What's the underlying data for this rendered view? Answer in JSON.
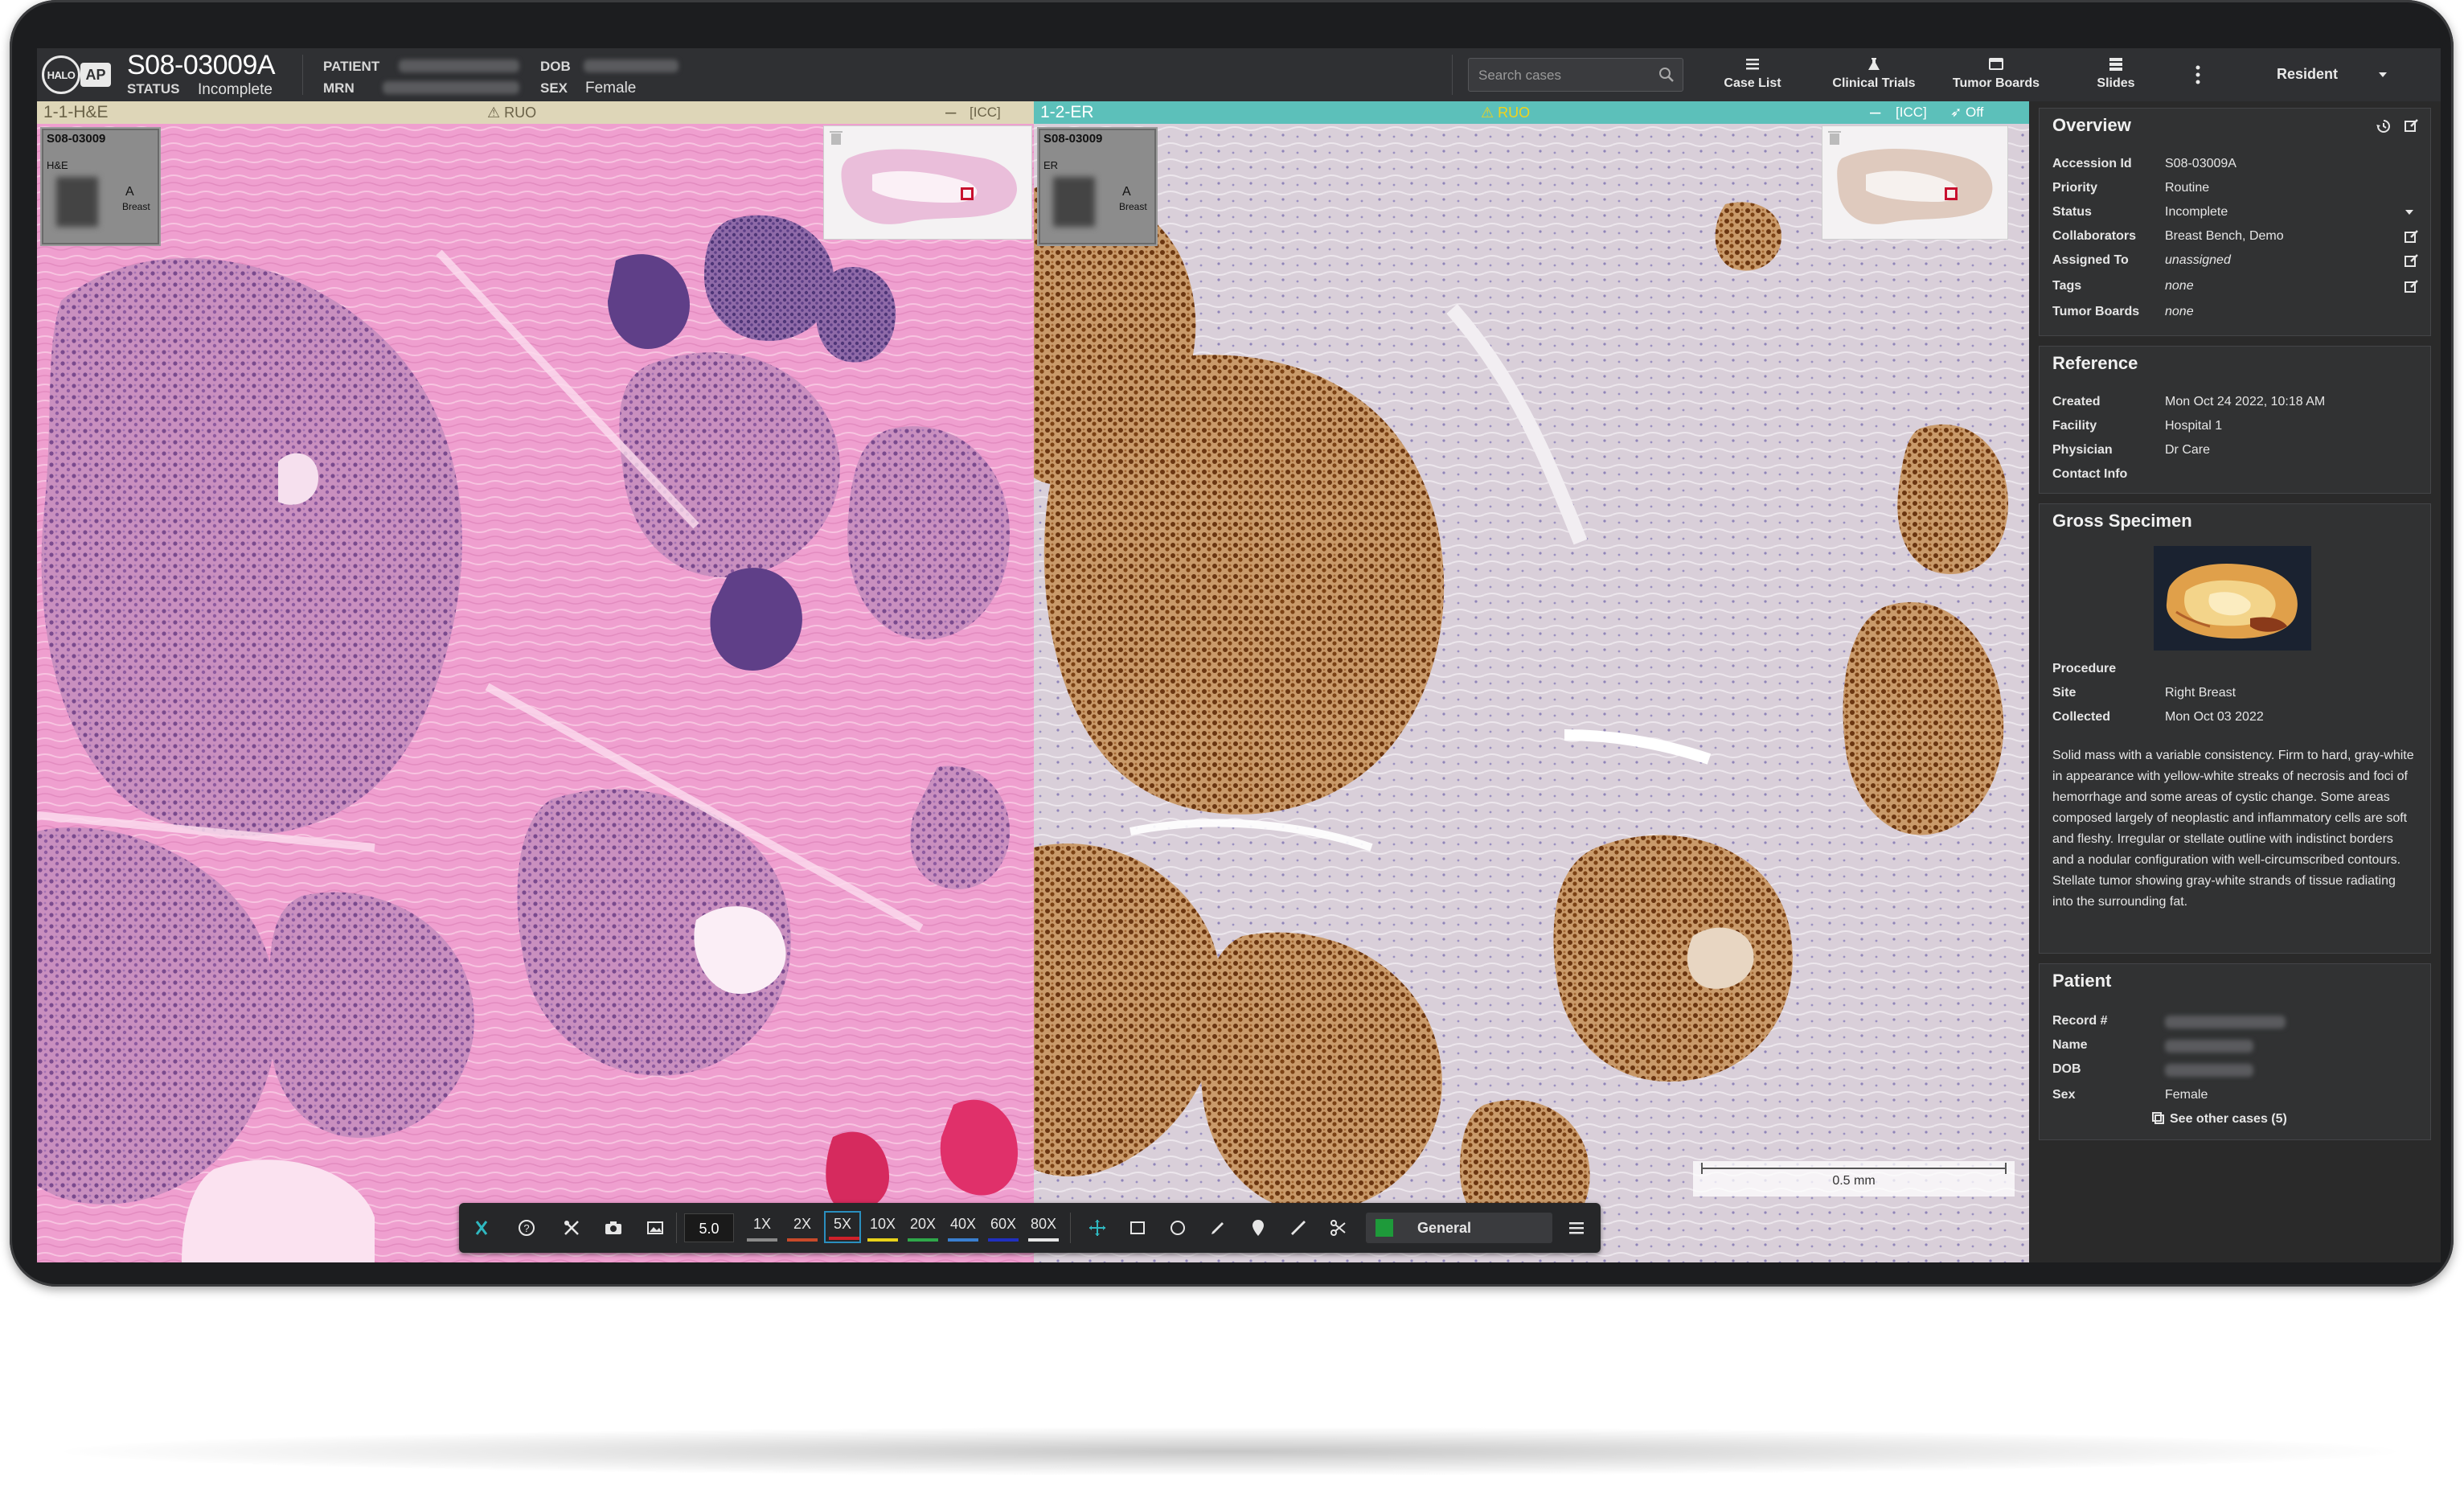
{
  "header": {
    "logo_halo": "HALO",
    "logo_ap": "AP",
    "case_id": "S08-03009A",
    "status_label": "STATUS",
    "status_value": "Incomplete",
    "patient_label": "PATIENT",
    "mrn_label": "MRN",
    "dob_label": "DOB",
    "sex_label": "SEX",
    "sex_value": "Female",
    "search_placeholder": "Search cases",
    "nav": [
      {
        "label": "Case List",
        "icon": "list-icon"
      },
      {
        "label": "Clinical Trials",
        "icon": "flask-icon"
      },
      {
        "label": "Tumor Boards",
        "icon": "board-icon"
      },
      {
        "label": "Slides",
        "icon": "slides-icon"
      }
    ],
    "user_label": "Resident"
  },
  "viewers": [
    {
      "title": "1-1-H&E",
      "ruo": "RUO",
      "icc": "[ICC]",
      "thumb_id": "S08-03009",
      "thumb_stain": "H&E",
      "thumb_letter": "A",
      "thumb_site": "Breast"
    },
    {
      "title": "1-2-ER",
      "ruo": "RUO",
      "icc": "[ICC]",
      "off": "Off",
      "thumb_id": "S08-03009",
      "thumb_stain": "ER",
      "thumb_letter": "A",
      "thumb_site": "Breast"
    }
  ],
  "scale_bar": "0.5 mm",
  "toolbar": {
    "zoom_value": "5.0",
    "magnifications": [
      {
        "label": "1X",
        "color": "#8a8a8a"
      },
      {
        "label": "2X",
        "color": "#c84a2a"
      },
      {
        "label": "5X",
        "color": "#d0202a",
        "active": true
      },
      {
        "label": "10X",
        "color": "#e8d21a"
      },
      {
        "label": "20X",
        "color": "#2fa84a"
      },
      {
        "label": "40X",
        "color": "#3a7fd0"
      },
      {
        "label": "60X",
        "color": "#2030c0"
      },
      {
        "label": "80X",
        "color": "#e6e6e6"
      }
    ],
    "layer_name": "General",
    "layer_color": "#1e9a3a"
  },
  "overview": {
    "title": "Overview",
    "rows": [
      {
        "key": "Accession Id",
        "value": "S08-03009A"
      },
      {
        "key": "Priority",
        "value": "Routine"
      },
      {
        "key": "Status",
        "value": "Incomplete"
      },
      {
        "key": "Collaborators",
        "value": "Breast Bench, Demo"
      },
      {
        "key": "Assigned To",
        "value": "unassigned"
      },
      {
        "key": "Tags",
        "value": "none"
      },
      {
        "key": "Tumor Boards",
        "value": "none"
      }
    ]
  },
  "reference": {
    "title": "Reference",
    "rows": [
      {
        "key": "Created",
        "value": "Mon Oct 24 2022, 10:18 AM"
      },
      {
        "key": "Facility",
        "value": "Hospital 1"
      },
      {
        "key": "Physician",
        "value": "Dr Care"
      },
      {
        "key": "Contact Info",
        "value": ""
      }
    ]
  },
  "gross": {
    "title": "Gross Specimen",
    "rows": [
      {
        "key": "Procedure",
        "value": ""
      },
      {
        "key": "Site",
        "value": "Right Breast"
      },
      {
        "key": "Collected",
        "value": "Mon Oct 03 2022"
      }
    ],
    "description": "Solid mass with a variable consistency. Firm to hard, gray-white in appearance with yellow-white streaks of necrosis and foci of hemorrhage and some areas of cystic change. Some areas composed largely of neoplastic and inflammatory cells are soft and fleshy. Irregular or stellate outline with indistinct borders and a nodular configuration with well-circumscribed contours. Stellate tumor showing gray-white strands of tissue radiating into the surrounding fat."
  },
  "patient": {
    "title": "Patient",
    "rows": [
      {
        "key": "Record #",
        "value": ""
      },
      {
        "key": "Name",
        "value": ""
      },
      {
        "key": "DOB",
        "value": ""
      },
      {
        "key": "Sex",
        "value": "Female"
      }
    ],
    "other_cases": "See other cases (5)"
  }
}
